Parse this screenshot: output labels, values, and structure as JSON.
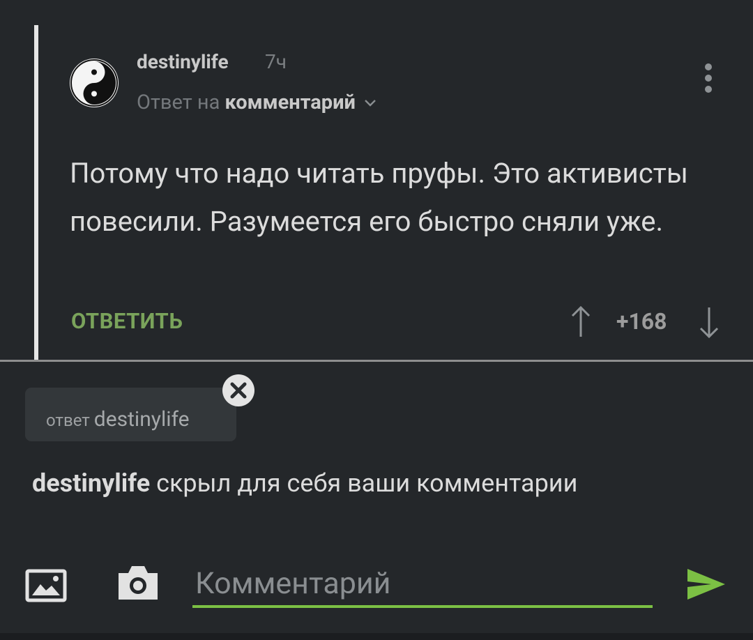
{
  "comment": {
    "username": "destinylife",
    "time": "7ч",
    "reply_prefix": "Ответ на",
    "reply_target": "комментарий",
    "text": "Потому что надо читать пруфы. Это активисты повесили. Разумеется его быстро сняли уже.",
    "reply_button": "ОТВЕТИТЬ",
    "rating": "+168"
  },
  "composer": {
    "reply_chip_prefix": "ответ",
    "reply_chip_name": "destinylife",
    "hidden_user": "destinylife",
    "hidden_text": "скрыл для себя ваши комментарии",
    "placeholder": "Комментарий"
  },
  "icons": [
    "avatar-yin-yang",
    "more-vert-icon",
    "arrow-up-icon",
    "arrow-down-icon",
    "close-icon",
    "image-icon",
    "camera-icon",
    "send-icon"
  ],
  "colors": {
    "accent_green": "#7cc044",
    "reply_green": "#7aa35b",
    "background": "#24272a"
  }
}
